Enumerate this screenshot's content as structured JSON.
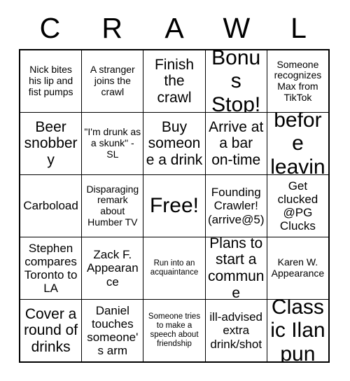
{
  "card": {
    "header_letters": [
      "C",
      "R",
      "A",
      "W",
      "L"
    ],
    "rows": [
      [
        {
          "text": "Nick bites his lip and fist pumps",
          "size": "fs-sm",
          "free": false
        },
        {
          "text": "A stranger joins the crawl",
          "size": "fs-sm",
          "free": false
        },
        {
          "text": "Finish the crawl",
          "size": "fs-lg",
          "free": false
        },
        {
          "text": "Bonus Stop!",
          "size": "fs-xl",
          "free": false
        },
        {
          "text": "Someone recognizes Max from TikTok",
          "size": "fs-sm",
          "free": false
        }
      ],
      [
        {
          "text": "Beer snobbery",
          "size": "fs-lg",
          "free": false
        },
        {
          "text": "\"I'm drunk as a skunk\" - SL",
          "size": "fs-sm",
          "free": false
        },
        {
          "text": "Buy someone a drink",
          "size": "fs-lg",
          "free": false
        },
        {
          "text": "Arrive at a bar on-time",
          "size": "fs-lg",
          "free": false
        },
        {
          "text": "Chug before leaving",
          "size": "fs-xl",
          "free": false
        }
      ],
      [
        {
          "text": "Carboload",
          "size": "fs-md",
          "free": false
        },
        {
          "text": "Disparaging remark about Humber TV",
          "size": "fs-sm",
          "free": false
        },
        {
          "text": "Free!",
          "size": "fs-xl",
          "free": true
        },
        {
          "text": "Founding Crawler! (arrive@5)",
          "size": "fs-md",
          "free": false
        },
        {
          "text": "Get clucked @PG Clucks",
          "size": "fs-md",
          "free": false
        }
      ],
      [
        {
          "text": "Stephen compares Toronto to LA",
          "size": "fs-md",
          "free": false
        },
        {
          "text": "Zack F. Appearance",
          "size": "fs-md",
          "free": false
        },
        {
          "text": "Run into an acquaintance",
          "size": "fs-xs",
          "free": false
        },
        {
          "text": "Plans to start a commune",
          "size": "fs-lg",
          "free": false
        },
        {
          "text": "Karen W. Appearance",
          "size": "fs-sm",
          "free": false
        }
      ],
      [
        {
          "text": "Cover a round of drinks",
          "size": "fs-lg",
          "free": false
        },
        {
          "text": "Daniel touches someone's arm",
          "size": "fs-md",
          "free": false
        },
        {
          "text": "Someone tries to make a speech about friendship",
          "size": "fs-xs",
          "free": false
        },
        {
          "text": "ill-advised extra drink/shot",
          "size": "fs-md",
          "free": false
        },
        {
          "text": "Classic Ilan pun",
          "size": "fs-xl",
          "free": false
        }
      ]
    ]
  },
  "colors": {
    "background": "#ffffff",
    "text": "#000000",
    "grid_line": "#000000"
  }
}
